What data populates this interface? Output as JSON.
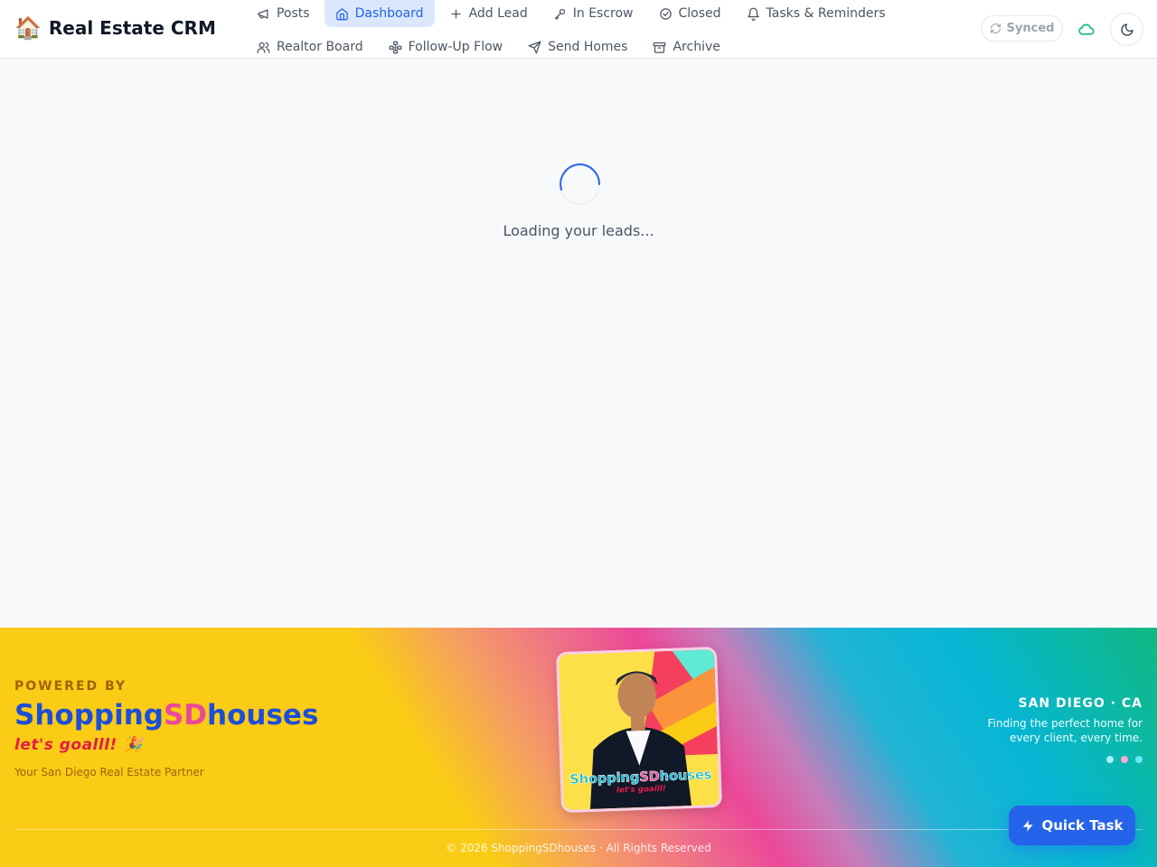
{
  "header": {
    "brand_emoji": "🏠",
    "brand_title": "Real Estate CRM",
    "nav_row1": [
      {
        "label": "Posts",
        "icon": "megaphone-icon"
      },
      {
        "label": "Dashboard",
        "icon": "home-icon",
        "active": true
      },
      {
        "label": "Add Lead",
        "icon": "plus-icon"
      },
      {
        "label": "In Escrow",
        "icon": "key-icon"
      },
      {
        "label": "Closed",
        "icon": "check-circle-icon"
      },
      {
        "label": "Tasks & Reminders",
        "icon": "bell-icon"
      }
    ],
    "nav_row2": [
      {
        "label": "Realtor Board",
        "icon": "users-icon"
      },
      {
        "label": "Follow-Up Flow",
        "icon": "workflow-icon"
      },
      {
        "label": "Send Homes",
        "icon": "send-icon"
      },
      {
        "label": "Archive",
        "icon": "archive-icon"
      }
    ],
    "sync_status": "Synced",
    "cloud_icon": "cloud-icon",
    "theme_icon": "moon-icon"
  },
  "main": {
    "loading_text": "Loading your leads..."
  },
  "footer": {
    "powered_by": "POWERED BY",
    "brand_part1": "Shopping",
    "brand_part2": "SD",
    "brand_part3": "houses",
    "tagline": "let's goalll! 🎉",
    "partner_text": "Your San Diego Real Estate Partner",
    "photo_brand_1": "Shopping",
    "photo_brand_2": "SD",
    "photo_brand_3": "houses",
    "photo_tagline": "let's goalll!",
    "location_title": "SAN DIEGO · CA",
    "location_sub": "Finding the perfect home for every client, every time.",
    "dot_colors": [
      "#a5f3fc",
      "#f9a8d4",
      "#67e8f9"
    ],
    "copyright": "© 2026 ShoppingSDhouses · All Rights Reserved"
  },
  "quick_task": {
    "label": "Quick Task"
  },
  "colors": {
    "accent": "#2563eb",
    "active_nav_bg": "#dbe8fb",
    "sync_cloud": "#10b981"
  }
}
